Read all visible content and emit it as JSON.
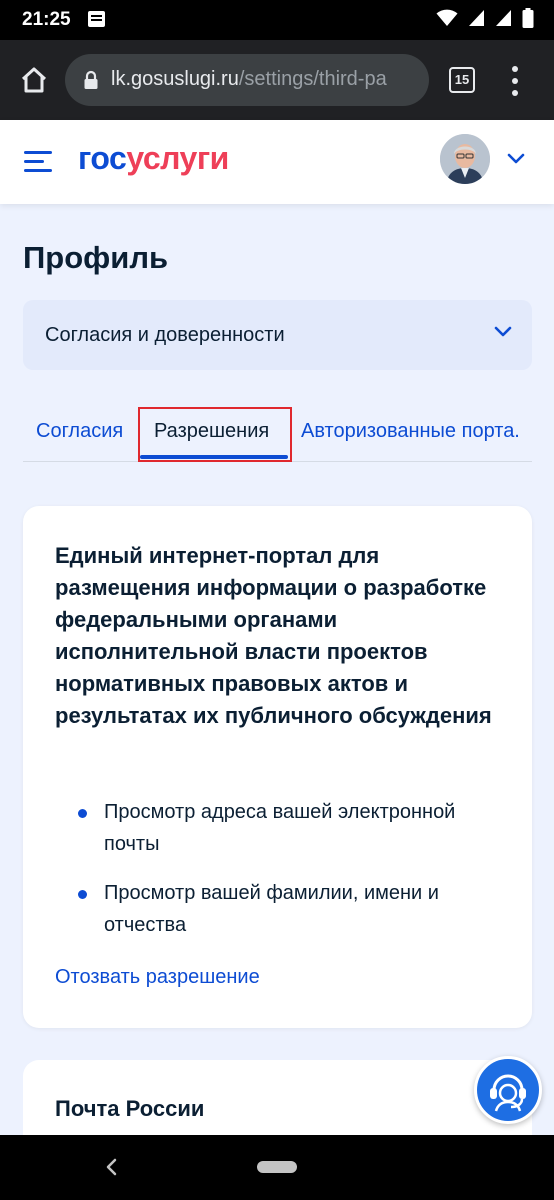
{
  "status_bar": {
    "time": "21:25",
    "icons": [
      "message-notification-icon",
      "wifi-icon",
      "cellular-signal-icon",
      "cellular-signal-icon",
      "battery-icon"
    ]
  },
  "browser": {
    "url_host": "lk.gosuslugi.ru",
    "url_path": "/settings/third-pa",
    "tab_count": "15"
  },
  "header": {
    "logo_part1": "гос",
    "logo_part2": "услуги"
  },
  "main": {
    "title": "Профиль",
    "dropdown_label": "Согласия и доверенности",
    "tabs": [
      {
        "label": "Согласия"
      },
      {
        "label": "Разрешения"
      },
      {
        "label": "Авторизованные порта."
      }
    ],
    "active_tab": "Разрешения",
    "card": {
      "title": "Единый интернет-портал для размещения информации о разработке федеральными органами исполнительной власти проектов нормативных правовых актов и результатах их публичного обсуждения",
      "permissions": [
        "Просмотр адреса вашей электронной почты",
        "Просмотр вашей фамилии, имени и отчества"
      ],
      "revoke_label": "Отозвать разрешение"
    },
    "card2": {
      "title": "Почта России"
    }
  },
  "colors": {
    "accent": "#0d4cd3",
    "logo_red": "#ee3f58",
    "page_bg": "#edf2fe",
    "highlight": "#e0282e"
  }
}
